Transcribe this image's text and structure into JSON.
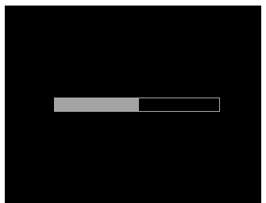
{
  "progress": {
    "value_fraction": 0.51,
    "fill_color": "#a3a3a3",
    "track_border_color": "#a8a8a8",
    "background_color": "#000000"
  }
}
